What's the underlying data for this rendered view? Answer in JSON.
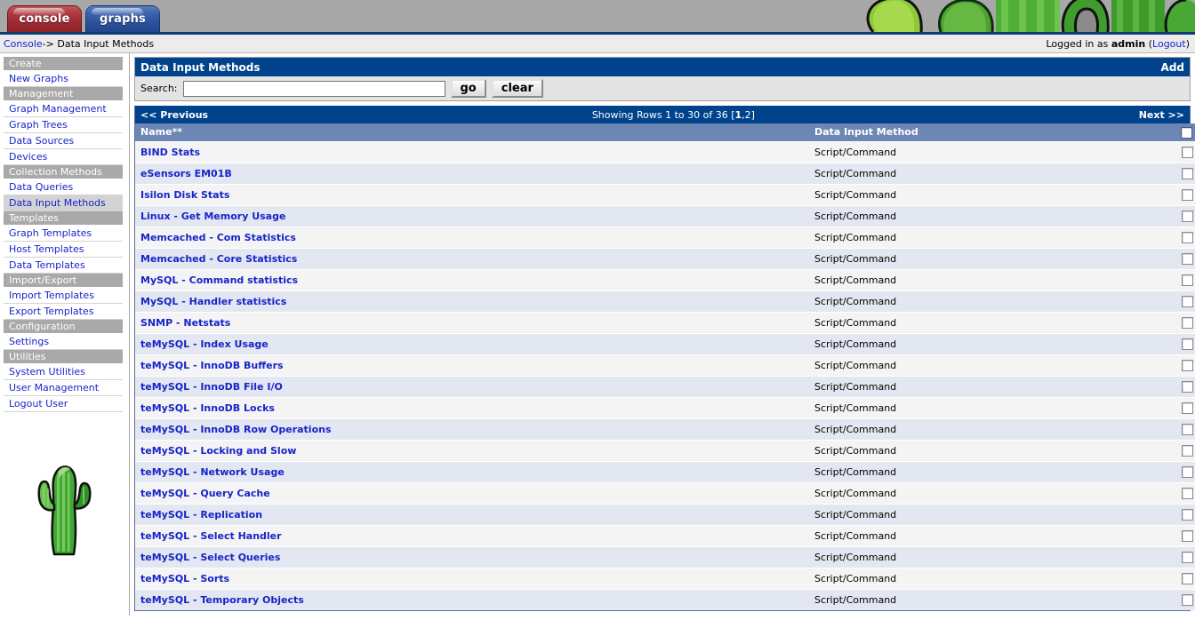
{
  "banner": {
    "tabs": [
      {
        "id": "console",
        "label": "console",
        "active": true
      },
      {
        "id": "graphs",
        "label": "graphs",
        "active": false
      }
    ],
    "artwork": "cactus-banner-graphic"
  },
  "breadcrumb": {
    "home_label": "Console",
    "separator": "->",
    "current": "Data Input Methods",
    "login_prefix": "Logged in as ",
    "login_user": "admin",
    "login_paren_open": " (",
    "logout_label": "Logout",
    "login_paren_close": ")"
  },
  "sidebar": {
    "groups": [
      {
        "header": "Create",
        "items": [
          {
            "label": "New Graphs",
            "selected": false
          }
        ]
      },
      {
        "header": "Management",
        "items": [
          {
            "label": "Graph Management",
            "selected": false
          },
          {
            "label": "Graph Trees",
            "selected": false
          },
          {
            "label": "Data Sources",
            "selected": false
          },
          {
            "label": "Devices",
            "selected": false
          }
        ]
      },
      {
        "header": "Collection Methods",
        "items": [
          {
            "label": "Data Queries",
            "selected": false
          },
          {
            "label": "Data Input Methods",
            "selected": true
          }
        ]
      },
      {
        "header": "Templates",
        "items": [
          {
            "label": "Graph Templates",
            "selected": false
          },
          {
            "label": "Host Templates",
            "selected": false
          },
          {
            "label": "Data Templates",
            "selected": false
          }
        ]
      },
      {
        "header": "Import/Export",
        "items": [
          {
            "label": "Import Templates",
            "selected": false
          },
          {
            "label": "Export Templates",
            "selected": false
          }
        ]
      },
      {
        "header": "Configuration",
        "items": [
          {
            "label": "Settings",
            "selected": false
          }
        ]
      },
      {
        "header": "Utilities",
        "items": [
          {
            "label": "System Utilities",
            "selected": false
          },
          {
            "label": "User Management",
            "selected": false
          },
          {
            "label": "Logout User",
            "selected": false
          }
        ]
      }
    ],
    "logo": "cactus-logo"
  },
  "panel": {
    "title": "Data Input Methods",
    "add_label": "Add",
    "search_label": "Search:",
    "search_value": "",
    "search_placeholder": "",
    "go_label": "go",
    "clear_label": "clear"
  },
  "pagination": {
    "previous_label": "<< Previous",
    "showing_prefix": "Showing Rows 1 to 30 of 36 [",
    "page_current": "1",
    "page_separator": ",",
    "page_next": "2",
    "showing_suffix": "]",
    "next_label": "Next >>"
  },
  "table": {
    "columns": [
      {
        "key": "name",
        "label": "Name**"
      },
      {
        "key": "method",
        "label": "Data Input Method"
      },
      {
        "key": "select",
        "label": ""
      }
    ],
    "rows": [
      {
        "name": "BIND Stats",
        "method": "Script/Command",
        "checked": false
      },
      {
        "name": "eSensors EM01B",
        "method": "Script/Command",
        "checked": false
      },
      {
        "name": "Isilon Disk Stats",
        "method": "Script/Command",
        "checked": false
      },
      {
        "name": "Linux - Get Memory Usage",
        "method": "Script/Command",
        "checked": false
      },
      {
        "name": "Memcached - Com Statistics",
        "method": "Script/Command",
        "checked": false
      },
      {
        "name": "Memcached - Core Statistics",
        "method": "Script/Command",
        "checked": false
      },
      {
        "name": "MySQL - Command statistics",
        "method": "Script/Command",
        "checked": false
      },
      {
        "name": "MySQL - Handler statistics",
        "method": "Script/Command",
        "checked": false
      },
      {
        "name": "SNMP - Netstats",
        "method": "Script/Command",
        "checked": false
      },
      {
        "name": "teMySQL - Index Usage",
        "method": "Script/Command",
        "checked": false
      },
      {
        "name": "teMySQL - InnoDB Buffers",
        "method": "Script/Command",
        "checked": false
      },
      {
        "name": "teMySQL - InnoDB File I/O",
        "method": "Script/Command",
        "checked": false
      },
      {
        "name": "teMySQL - InnoDB Locks",
        "method": "Script/Command",
        "checked": false
      },
      {
        "name": "teMySQL - InnoDB Row Operations",
        "method": "Script/Command",
        "checked": false
      },
      {
        "name": "teMySQL - Locking and Slow",
        "method": "Script/Command",
        "checked": false
      },
      {
        "name": "teMySQL - Network Usage",
        "method": "Script/Command",
        "checked": false
      },
      {
        "name": "teMySQL - Query Cache",
        "method": "Script/Command",
        "checked": false
      },
      {
        "name": "teMySQL - Replication",
        "method": "Script/Command",
        "checked": false
      },
      {
        "name": "teMySQL - Select Handler",
        "method": "Script/Command",
        "checked": false
      },
      {
        "name": "teMySQL - Select Queries",
        "method": "Script/Command",
        "checked": false
      },
      {
        "name": "teMySQL - Sorts",
        "method": "Script/Command",
        "checked": false
      },
      {
        "name": "teMySQL - Temporary Objects",
        "method": "Script/Command",
        "checked": false
      }
    ]
  },
  "colors": {
    "header_blue": "#00438c",
    "column_header_blue": "#6d87b4",
    "link_blue": "#1824c8",
    "row_odd": "#f4f4f5",
    "row_even": "#e3e7f1",
    "menu_header_gray": "#a9a9a9",
    "banner_gray": "#a8a8a8",
    "tab_console_red": "#9d2b30",
    "tab_graphs_blue": "#2c519d"
  }
}
